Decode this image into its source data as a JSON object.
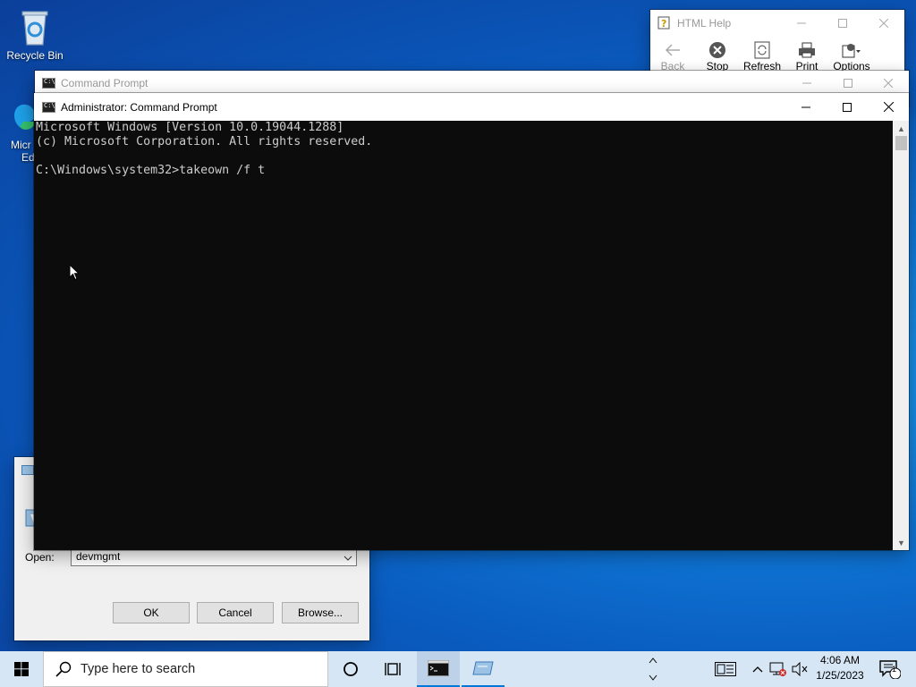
{
  "desktop": {
    "recycle_bin_label": "Recycle Bin",
    "edge_label_line1": "Micr",
    "edge_label_line2": "Ed"
  },
  "html_help": {
    "title": "HTML Help",
    "toolbar": {
      "back": "Back",
      "stop": "Stop",
      "refresh": "Refresh",
      "print": "Print",
      "options": "Options"
    }
  },
  "cmd_back": {
    "title": "Command Prompt"
  },
  "cmd": {
    "title": "Administrator: Command Prompt",
    "lines": [
      "Microsoft Windows [Version 10.0.19044.1288]",
      "(c) Microsoft Corporation. All rights reserved.",
      "",
      "C:\\Windows\\system32>takeown /f t"
    ]
  },
  "run_dialog": {
    "open_label": "Open:",
    "open_value": "devmgmt",
    "ok": "OK",
    "cancel": "Cancel",
    "browse": "Browse..."
  },
  "taskbar": {
    "search_placeholder": "Type here to search",
    "time": "4:06 AM",
    "date": "1/25/2023",
    "notification_count": "1"
  },
  "colors": {
    "console_bg": "#0c0c0c",
    "console_fg": "#cccccc",
    "taskbar_bg": "#d7e6f5",
    "accent": "#0078d7"
  }
}
